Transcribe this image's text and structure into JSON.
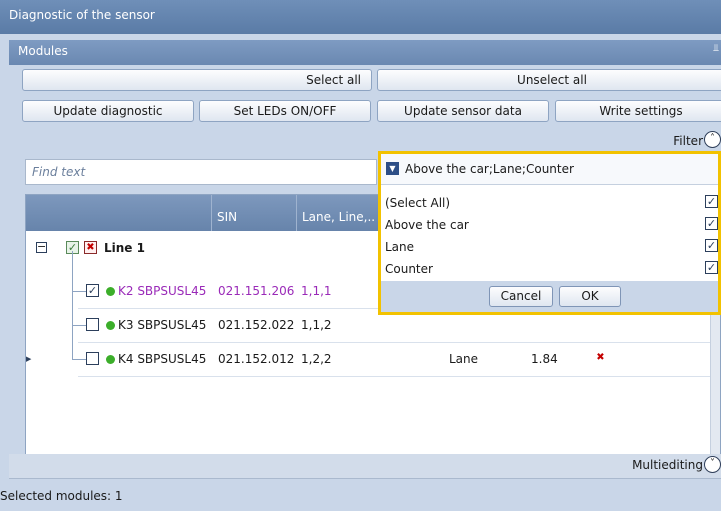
{
  "window": {
    "title": "Diagnostic of the sensor"
  },
  "panel": {
    "title": "Modules",
    "pin_icon": "pin-icon"
  },
  "toolbar": {
    "select_all": "Select all",
    "unselect_all": "Unselect all",
    "update_diagnostic": "Update diagnostic",
    "set_leds": "Set LEDs ON/OFF",
    "update_sensor_data": "Update sensor data",
    "write_settings": "Write settings"
  },
  "filter": {
    "label": "Filter",
    "toggle_icon": "chevron-up-icon"
  },
  "search": {
    "placeholder": "Find text"
  },
  "grid": {
    "columns": [
      "SIN",
      "Lane, Line,.."
    ],
    "group": {
      "label": "Line 1"
    },
    "rows": [
      {
        "name": "K2 SBPSUSL45",
        "sin": "021.151.206",
        "lane": "1,1,1",
        "checked": true,
        "highlight": true,
        "type": "",
        "value": ""
      },
      {
        "name": "K3 SBPSUSL45",
        "sin": "021.152.022",
        "lane": "1,1,2",
        "checked": false,
        "highlight": false,
        "type": "",
        "value": ""
      },
      {
        "name": "K4 SBPSUSL45",
        "sin": "021.152.012",
        "lane": "1,2,2",
        "checked": false,
        "highlight": false,
        "type": "Lane",
        "value": "1.84"
      }
    ]
  },
  "dropdown": {
    "value": "Above the car;Lane;Counter",
    "items": [
      {
        "label": "(Select All)",
        "checked": true
      },
      {
        "label": "Above the car",
        "checked": true
      },
      {
        "label": "Lane",
        "checked": true
      },
      {
        "label": "Counter",
        "checked": true
      }
    ],
    "cancel": "Cancel",
    "ok": "OK"
  },
  "multiediting": {
    "label": "Multiediting",
    "toggle_icon": "chevron-down-icon"
  },
  "status": {
    "text": "Selected modules: 1"
  },
  "colors": {
    "accent": "#2d4e86",
    "highlight_border": "#f2c200",
    "purple_text": "#9a2ab8",
    "status_dot": "#3cae2a"
  }
}
